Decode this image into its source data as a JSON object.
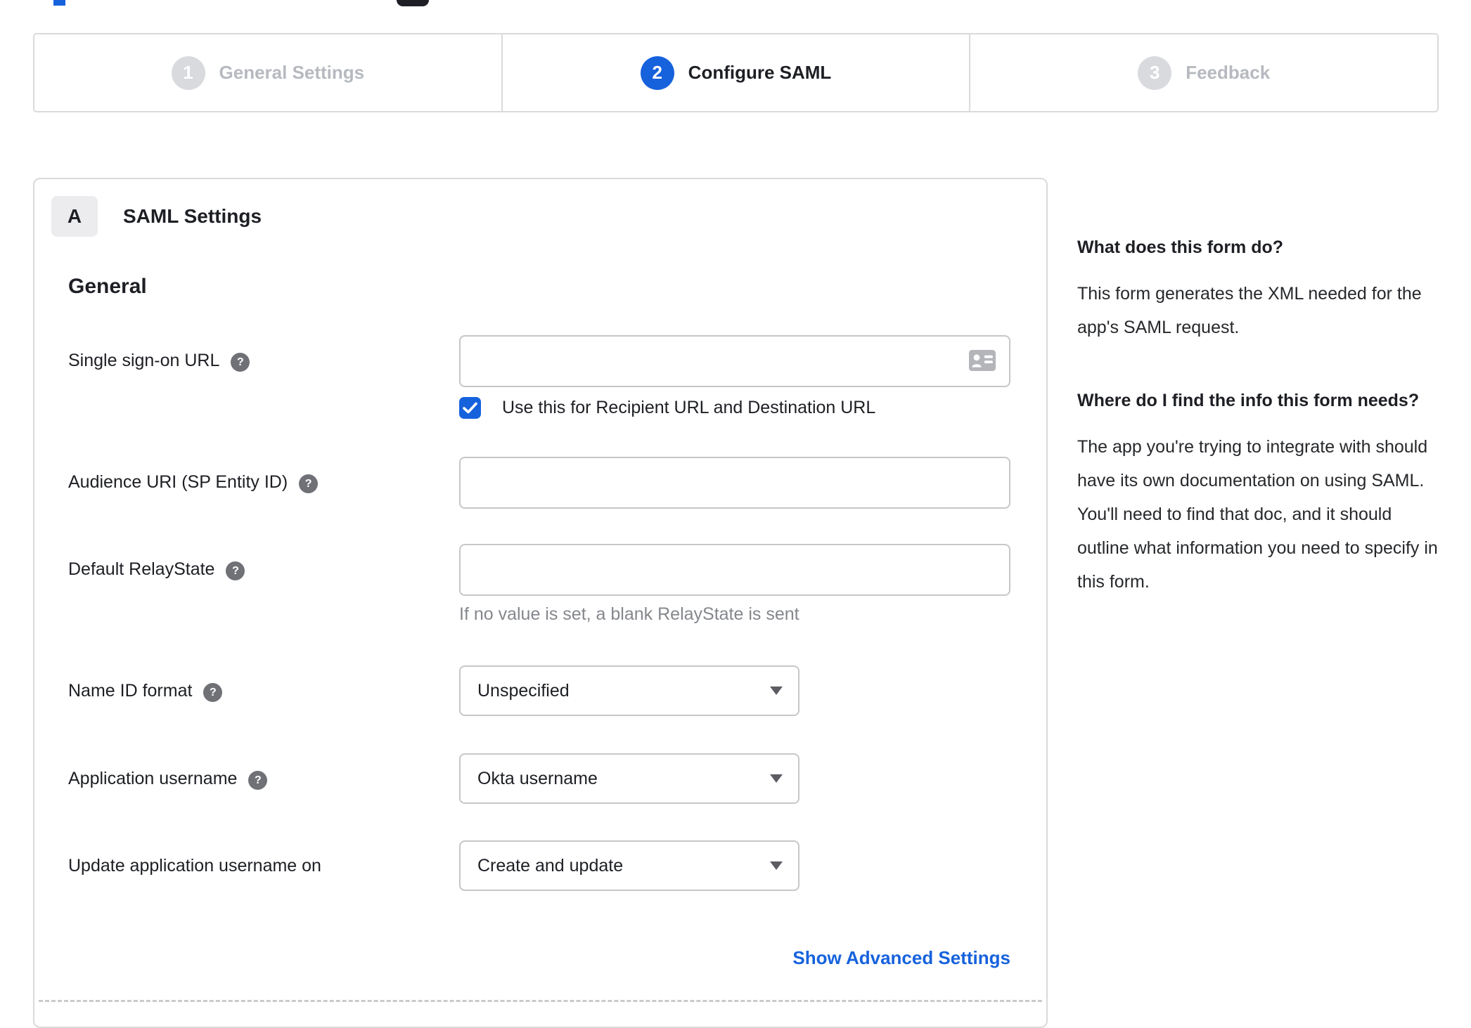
{
  "colors": {
    "accent_blue": "#1662dd",
    "inactive_gray": "#b6b9bf",
    "border_gray": "#d9dadc"
  },
  "stepper": {
    "steps": [
      {
        "number": "1",
        "label": "General Settings",
        "state": "inactive"
      },
      {
        "number": "2",
        "label": "Configure SAML",
        "state": "active"
      },
      {
        "number": "3",
        "label": "Feedback",
        "state": "inactive"
      }
    ]
  },
  "panel": {
    "badge": "A",
    "title": "SAML Settings",
    "section": "General",
    "fields": [
      {
        "label": "Single sign-on URL",
        "value": "",
        "checkbox_label": "Use this for Recipient URL and Destination URL",
        "checkbox_checked": true
      },
      {
        "label": "Audience URI (SP Entity ID)",
        "value": ""
      },
      {
        "label": "Default RelayState",
        "value": "",
        "hint": "If no value is set, a blank RelayState is sent"
      },
      {
        "label": "Name ID format",
        "value": "Unspecified"
      },
      {
        "label": "Application username",
        "value": "Okta username"
      },
      {
        "label": "Update application username on",
        "value": "Create and update"
      }
    ],
    "help_icon_glyph": "?",
    "advanced_link": "Show Advanced Settings"
  },
  "help_panel": {
    "sections": [
      {
        "heading": "What does this form do?",
        "body": "This form generates the XML needed for the app's SAML request."
      },
      {
        "heading": "Where do I find the info this form needs?",
        "body": "The app you're trying to integrate with should have its own documentation on using SAML. You'll need to find that doc, and it should outline what information you need to specify in this form."
      }
    ]
  }
}
